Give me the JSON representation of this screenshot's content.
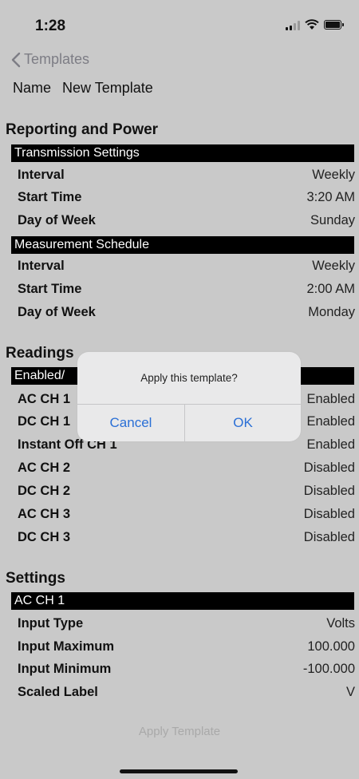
{
  "status": {
    "time": "1:28"
  },
  "nav": {
    "back_label": "Templates"
  },
  "name": {
    "label": "Name",
    "value": "New Template"
  },
  "reporting": {
    "title": "Reporting and Power",
    "transmission": {
      "header": "Transmission Settings",
      "rows": [
        {
          "label": "Interval",
          "value": "Weekly"
        },
        {
          "label": "Start Time",
          "value": "3:20 AM"
        },
        {
          "label": "Day of Week",
          "value": "Sunday"
        }
      ]
    },
    "measurement": {
      "header": "Measurement Schedule",
      "rows": [
        {
          "label": "Interval",
          "value": "Weekly"
        },
        {
          "label": "Start Time",
          "value": "2:00 AM"
        },
        {
          "label": "Day of Week",
          "value": "Monday"
        }
      ]
    }
  },
  "readings": {
    "title": "Readings",
    "header": "Enabled/",
    "rows": [
      {
        "label": "AC CH 1",
        "value": "Enabled"
      },
      {
        "label": "DC CH 1",
        "value": "Enabled"
      },
      {
        "label": "Instant Off CH 1",
        "value": "Enabled"
      },
      {
        "label": "AC CH 2",
        "value": "Disabled"
      },
      {
        "label": "DC CH 2",
        "value": "Disabled"
      },
      {
        "label": "AC CH 3",
        "value": "Disabled"
      },
      {
        "label": "DC CH 3",
        "value": "Disabled"
      }
    ]
  },
  "settings": {
    "title": "Settings",
    "header": "AC CH 1",
    "rows": [
      {
        "label": "Input Type",
        "value": "Volts"
      },
      {
        "label": "Input Maximum",
        "value": "100.000"
      },
      {
        "label": "Input Minimum",
        "value": "-100.000"
      },
      {
        "label": "Scaled Label",
        "value": "V"
      }
    ]
  },
  "apply_template_label": "Apply Template",
  "alert": {
    "message": "Apply this template?",
    "cancel_label": "Cancel",
    "ok_label": "OK"
  },
  "colors": {
    "background": "#c9c9c9",
    "accent": "#2a6fd6",
    "header_bg": "#000000",
    "muted": "#a9a9a9"
  }
}
